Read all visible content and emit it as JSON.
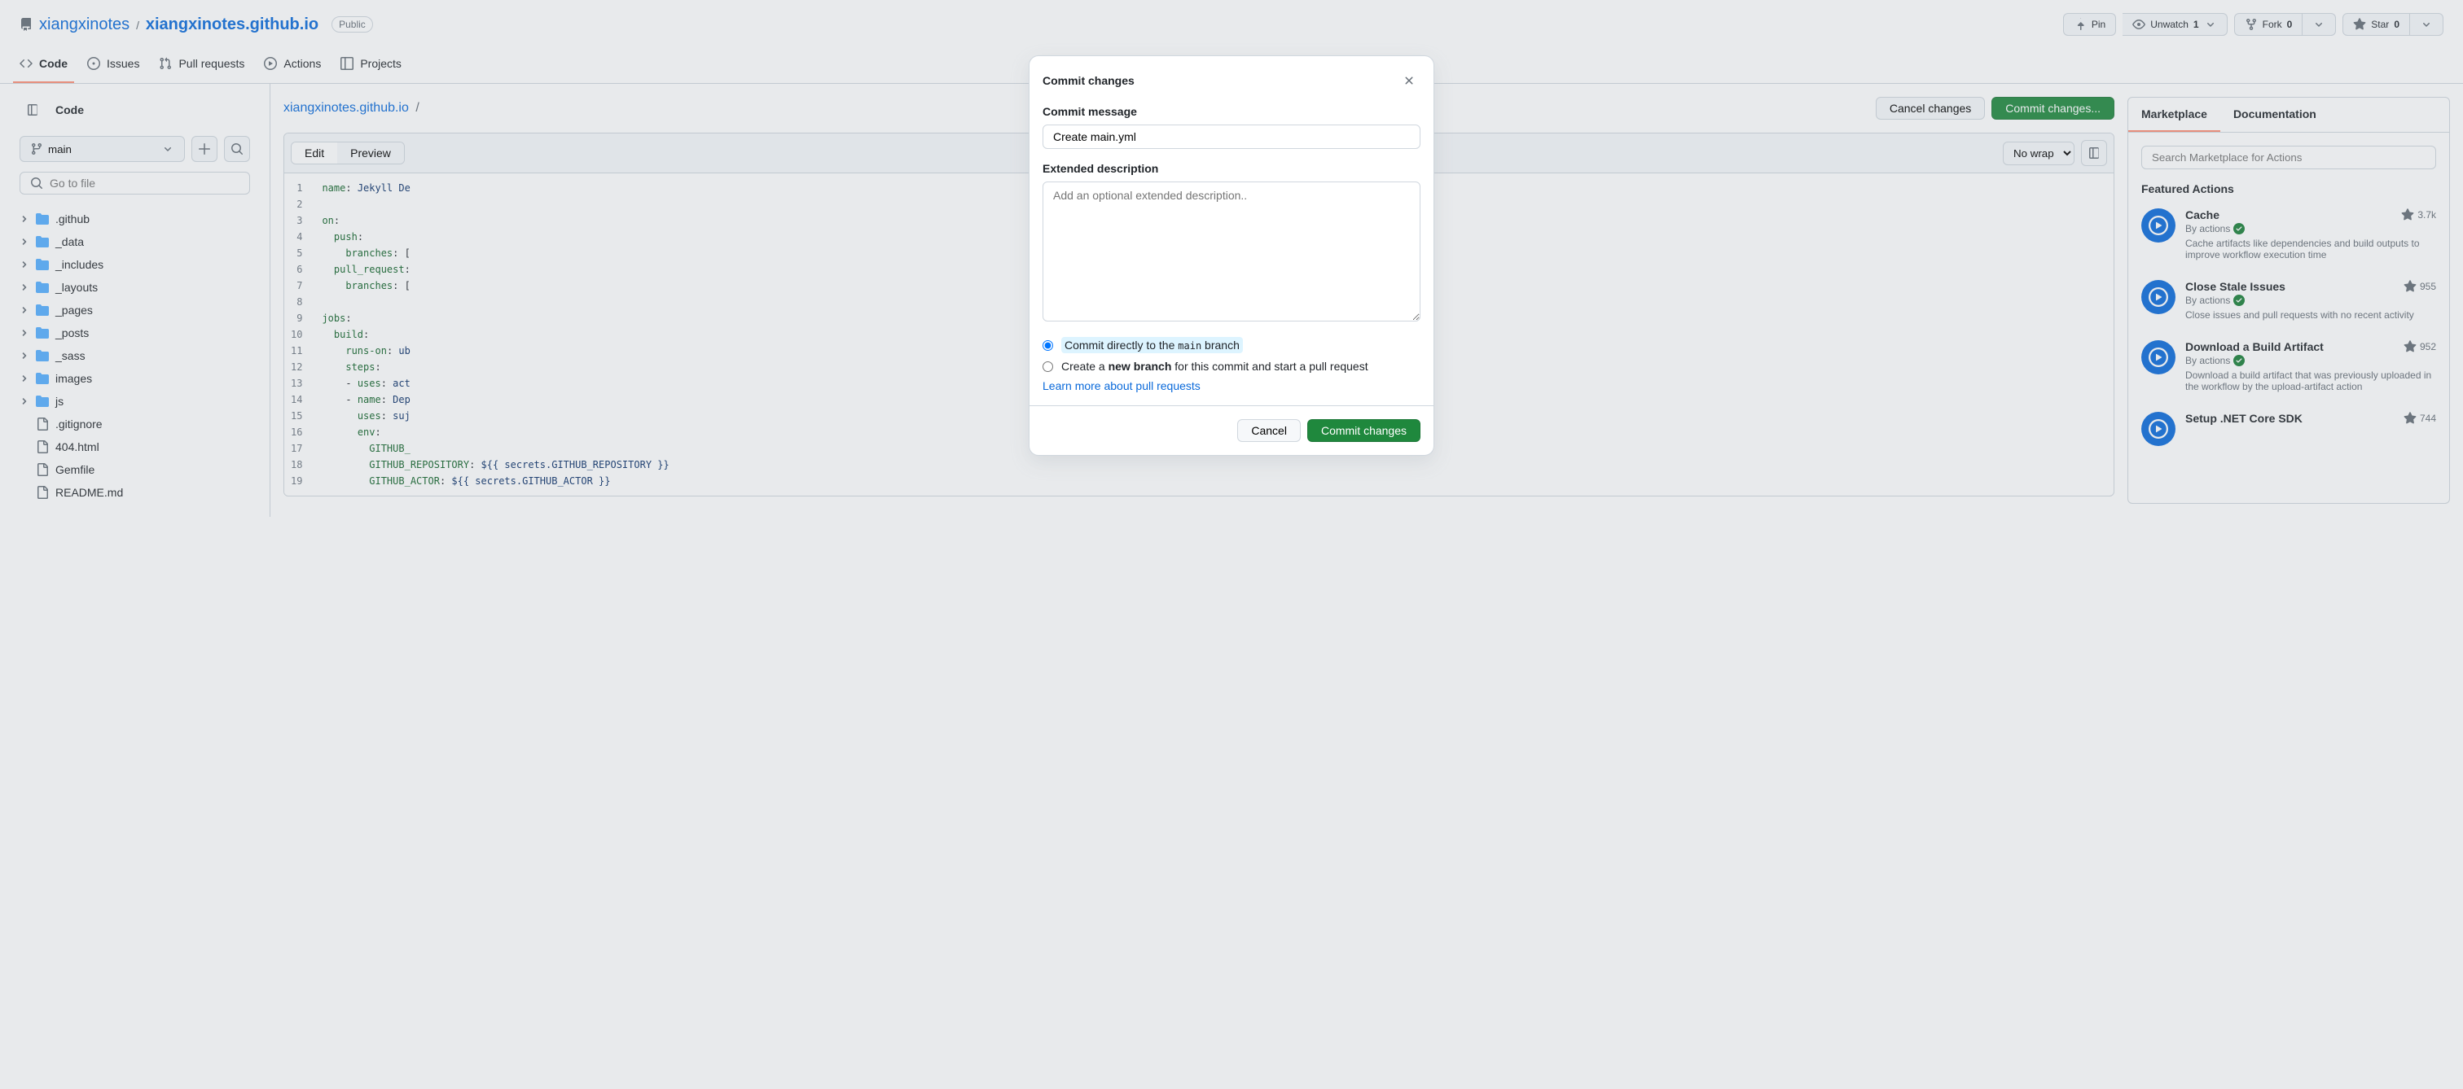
{
  "header": {
    "owner": "xiangxinotes",
    "repo": "xiangxinotes.github.io",
    "badge": "Public",
    "pin": "Pin",
    "unwatch": "Unwatch",
    "watch_count": "1",
    "fork": "Fork",
    "fork_count": "0",
    "star": "Star",
    "star_count": "0"
  },
  "nav": {
    "code": "Code",
    "issues": "Issues",
    "pr": "Pull requests",
    "actions": "Actions",
    "projects": "Projects"
  },
  "sidebar": {
    "title": "Code",
    "branch": "main",
    "search_placeholder": "Go to file",
    "items": [
      {
        "type": "folder",
        "name": ".github"
      },
      {
        "type": "folder",
        "name": "_data"
      },
      {
        "type": "folder",
        "name": "_includes"
      },
      {
        "type": "folder",
        "name": "_layouts"
      },
      {
        "type": "folder",
        "name": "_pages"
      },
      {
        "type": "folder",
        "name": "_posts"
      },
      {
        "type": "folder",
        "name": "_sass"
      },
      {
        "type": "folder",
        "name": "images"
      },
      {
        "type": "folder",
        "name": "js"
      },
      {
        "type": "file",
        "name": ".gitignore"
      },
      {
        "type": "file",
        "name": "404.html"
      },
      {
        "type": "file",
        "name": "Gemfile"
      },
      {
        "type": "file",
        "name": "README.md"
      }
    ]
  },
  "editor": {
    "path_repo": "xiangxinotes.github.io",
    "cancel": "Cancel changes",
    "commit": "Commit changes...",
    "edit": "Edit",
    "preview": "Preview",
    "wrap": "No wrap",
    "lines": [
      {
        "n": "1",
        "html": "<span class='k'>name</span>: <span class='s'>Jekyll De</span>"
      },
      {
        "n": "2",
        "html": ""
      },
      {
        "n": "3",
        "html": "<span class='k'>on</span>:"
      },
      {
        "n": "4",
        "html": "  <span class='k'>push</span>:"
      },
      {
        "n": "5",
        "html": "    <span class='k'>branches</span>: ["
      },
      {
        "n": "6",
        "html": "  <span class='k'>pull_request</span>:"
      },
      {
        "n": "7",
        "html": "    <span class='k'>branches</span>: ["
      },
      {
        "n": "8",
        "html": ""
      },
      {
        "n": "9",
        "html": "<span class='k'>jobs</span>:"
      },
      {
        "n": "10",
        "html": "  <span class='k'>build</span>:"
      },
      {
        "n": "11",
        "html": "    <span class='k'>runs-on</span>: <span class='s'>ub</span>"
      },
      {
        "n": "12",
        "html": "    <span class='k'>steps</span>:"
      },
      {
        "n": "13",
        "html": "    - <span class='k'>uses</span>: <span class='s'>act</span>"
      },
      {
        "n": "14",
        "html": "    - <span class='k'>name</span>: <span class='s'>Dep</span>"
      },
      {
        "n": "15",
        "html": "      <span class='k'>uses</span>: <span class='s'>suj</span>"
      },
      {
        "n": "16",
        "html": "      <span class='k'>env</span>:"
      },
      {
        "n": "17",
        "html": "        <span class='k'>GITHUB_</span>"
      },
      {
        "n": "18",
        "html": "        <span class='k'>GITHUB_REPOSITORY</span>: <span class='s'>${{ secrets.GITHUB_REPOSITORY }}</span>"
      },
      {
        "n": "19",
        "html": "        <span class='k'>GITHUB_ACTOR</span>: <span class='s'>${{ secrets.GITHUB_ACTOR }}</span>"
      }
    ]
  },
  "marketplace": {
    "tab1": "Marketplace",
    "tab2": "Documentation",
    "search_placeholder": "Search Marketplace for Actions",
    "heading": "Featured Actions",
    "items": [
      {
        "title": "Cache",
        "by": "By actions",
        "desc": "Cache artifacts like dependencies and build outputs to improve workflow execution time",
        "stars": "3.7k"
      },
      {
        "title": "Close Stale Issues",
        "by": "By actions",
        "desc": "Close issues and pull requests with no recent activity",
        "stars": "955"
      },
      {
        "title": "Download a Build Artifact",
        "by": "By actions",
        "desc": "Download a build artifact that was previously uploaded in the workflow by the upload-artifact action",
        "stars": "952"
      },
      {
        "title": "Setup .NET Core SDK",
        "by": "",
        "desc": "",
        "stars": "744"
      }
    ]
  },
  "modal": {
    "title": "Commit changes",
    "msg_label": "Commit message",
    "msg_value": "Create main.yml",
    "desc_label": "Extended description",
    "desc_placeholder": "Add an optional extended description..",
    "radio1_pre": "Commit directly to the ",
    "radio1_branch": "main",
    "radio1_post": " branch",
    "radio2_pre": "Create a ",
    "radio2_bold": "new branch",
    "radio2_post": " for this commit and start a pull request",
    "learn": "Learn more about pull requests",
    "cancel": "Cancel",
    "commit": "Commit changes"
  }
}
